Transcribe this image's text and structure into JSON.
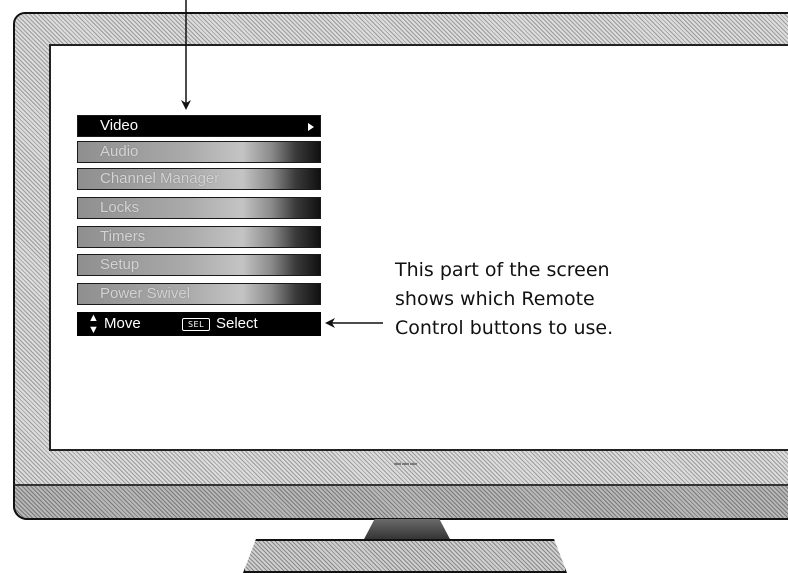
{
  "menu": {
    "items": [
      {
        "label": "Video",
        "selected": true,
        "has_submenu": true
      },
      {
        "label": "Audio",
        "selected": false
      },
      {
        "label": "Channel Manager",
        "selected": false
      },
      {
        "label": "Locks",
        "selected": false
      },
      {
        "label": "Timers",
        "selected": false
      },
      {
        "label": "Setup",
        "selected": false
      },
      {
        "label": "Power Swivel",
        "selected": false
      }
    ]
  },
  "help_bar": {
    "move_icon": "updown-arrows-icon",
    "move_label": "Move",
    "sel_icon_text": "SEL",
    "select_label": "Select"
  },
  "callout": {
    "lines": [
      "This part of the screen",
      "shows which Remote",
      "Control buttons to use."
    ]
  },
  "colors": {
    "selected_bg": "#000000",
    "selected_fg": "#ffffff",
    "screen_bg": "#ffffff",
    "bezel": "#c8c8c8"
  }
}
